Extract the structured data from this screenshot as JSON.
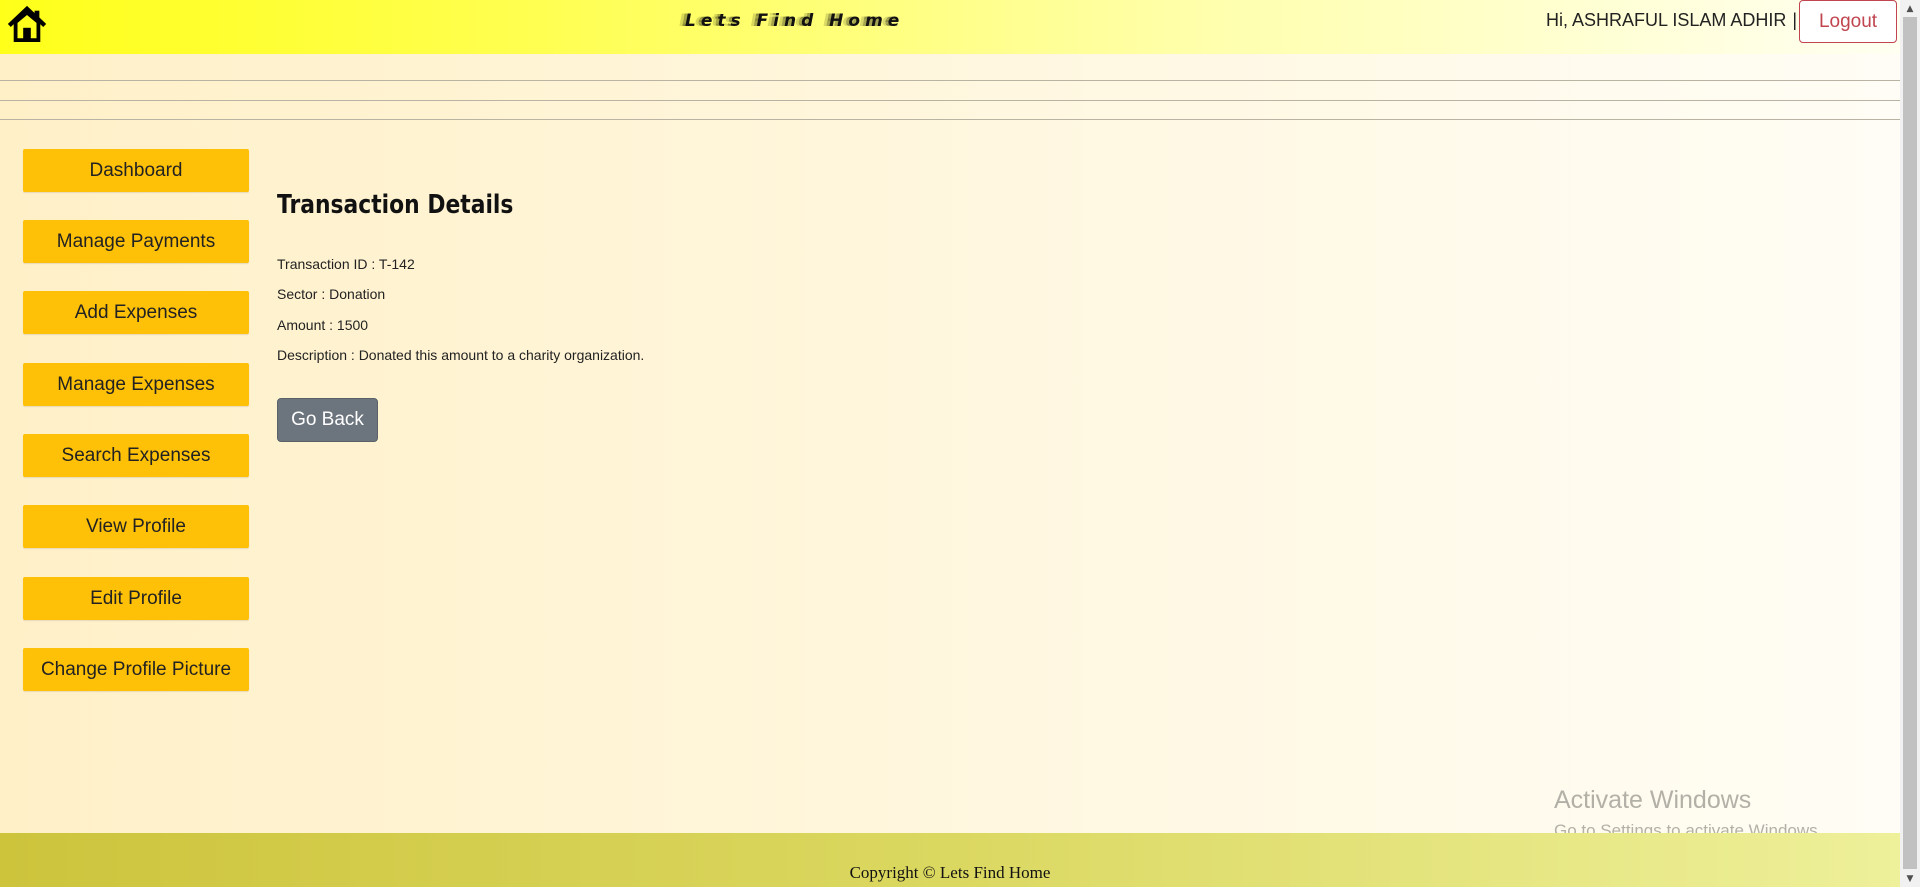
{
  "header": {
    "brand": "Lets Find Home",
    "greeting": "Hi, ASHRAFUL ISLAM ADHIR",
    "separator": "|",
    "logout_label": "Logout",
    "home_icon": "home-icon"
  },
  "sidebar": {
    "items": [
      {
        "label": "Dashboard"
      },
      {
        "label": "Manage Payments"
      },
      {
        "label": "Add Expenses"
      },
      {
        "label": "Manage Expenses"
      },
      {
        "label": "Search Expenses"
      },
      {
        "label": "View Profile"
      },
      {
        "label": "Edit Profile"
      },
      {
        "label": "Change Profile Picture"
      }
    ]
  },
  "main": {
    "title": "Transaction Details",
    "details": [
      "Transaction ID : T-142",
      "Sector : Donation",
      "Amount : 1500",
      "Description : Donated this amount to a charity organization."
    ],
    "go_back_label": "Go Back"
  },
  "watermark": {
    "line1": "Activate Windows",
    "line2": "Go to Settings to activate Windows."
  },
  "footer": {
    "copyright": "Copyright © Lets Find Home"
  },
  "colors": {
    "sidebar_button": "#ffc107",
    "go_back_button": "#6c757d",
    "logout_border": "#c0454f",
    "header_yellow": "#ffff1a",
    "footer_olive": "#cdc43c"
  }
}
